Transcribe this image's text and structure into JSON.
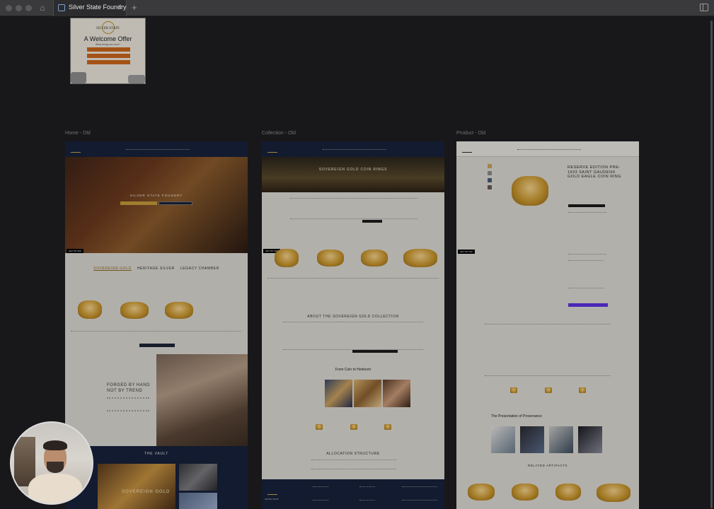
{
  "browser": {
    "tab_title": "Silver State Foundry",
    "close_glyph": "×",
    "new_tab_glyph": "+",
    "home_glyph": "⌂"
  },
  "frames": {
    "home_label": "Home - Old",
    "collection_label": "Collection - Old",
    "product_label": "Product - Old"
  },
  "popup": {
    "brand": "SILVER STATE",
    "title": "A Welcome Offer",
    "subtitle": "What brings you here?"
  },
  "home": {
    "hero_title": "SILVER STATE FOUNDRY",
    "sale_tag": "GET 5% OFF",
    "tabs": [
      "SOVEREIGN GOLD",
      "HERITAGE SILVER",
      "LEGACY CHAMBER"
    ],
    "forged_title_line1": "FORGED BY HAND",
    "forged_title_line2": "NOT BY TREND",
    "vault_title": "THE VAULT",
    "vault_word": "SOVEREIGN GOLD"
  },
  "collection": {
    "hero_title": "SOVEREIGN GOLD COIN RINGS",
    "sale_tag": "GET 5% OFF",
    "about_title": "ABOUT THE SOVEREIGN GOLD COLLECTION",
    "coin_title": "From Coin to Heirloom",
    "alloc_title": "ALLOCATION STRUCTURE",
    "footer_brand": "SILVER STATE"
  },
  "product": {
    "title": "RESERVE EDITION PRE-1933 SAINT GAUDENS GOLD EAGLE COIN RING",
    "sale_tag": "GET 5% OFF",
    "provenance_title": "The Presentation of Provenance",
    "related_title": "RELATED ARTIFACTS"
  }
}
